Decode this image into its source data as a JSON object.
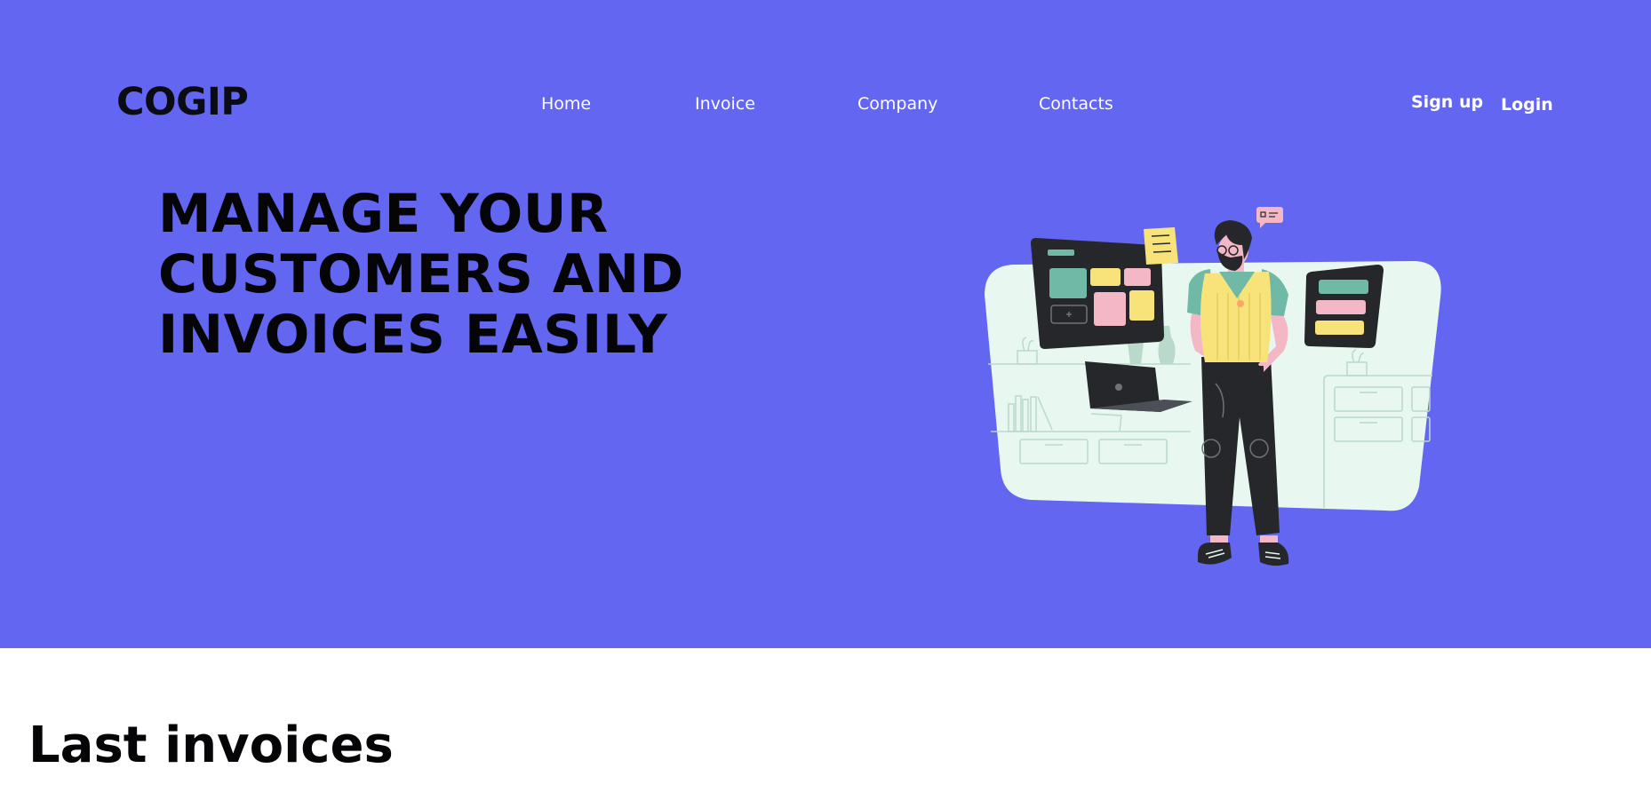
{
  "header": {
    "logo": "COGIP",
    "nav": [
      {
        "label": "Home"
      },
      {
        "label": "Invoice"
      },
      {
        "label": "Company"
      },
      {
        "label": "Contacts"
      }
    ],
    "signup_label": "Sign up",
    "login_label": "Login"
  },
  "hero": {
    "headline_lines": [
      "MANAGE YOUR",
      "CUSTOMERS AND",
      "INVOICES EASILY"
    ],
    "background_color": "#6366f1",
    "illustration": "person-with-dashboard-screens-illustration"
  },
  "main": {
    "section_title": "Last invoices"
  }
}
